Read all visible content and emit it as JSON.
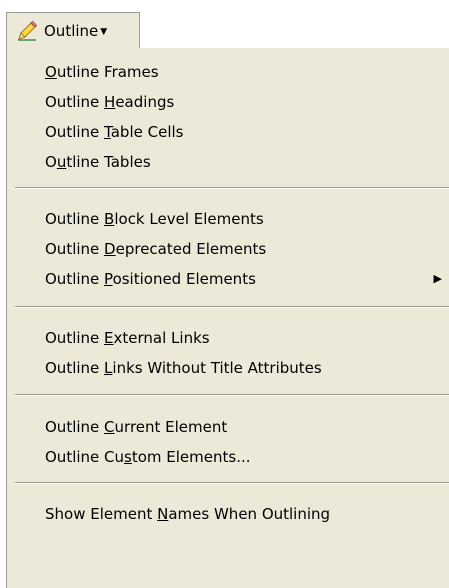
{
  "toolbar": {
    "button_label": "Outline",
    "button_icon": "pencil-icon",
    "dropdown_icon": "caret-down-icon"
  },
  "menu": {
    "groups": [
      {
        "items": [
          {
            "label": "Outline Frames",
            "mnemonic": "O"
          },
          {
            "label": "Outline Headings",
            "mnemonic": "H"
          },
          {
            "label": "Outline Table Cells",
            "mnemonic": "T"
          },
          {
            "label": "Outline Tables",
            "mnemonic": "u"
          }
        ]
      },
      {
        "items": [
          {
            "label": "Outline Block Level Elements",
            "mnemonic": "B"
          },
          {
            "label": "Outline Deprecated Elements",
            "mnemonic": "D"
          },
          {
            "label": "Outline Positioned Elements",
            "mnemonic": "P",
            "has_submenu": true,
            "submenu_icon": "submenu-arrow-icon"
          }
        ]
      },
      {
        "items": [
          {
            "label": "Outline External Links",
            "mnemonic": "E"
          },
          {
            "label": "Outline Links Without Title Attributes",
            "mnemonic": "L"
          }
        ]
      },
      {
        "items": [
          {
            "label": "Outline Current Element",
            "mnemonic": "C"
          },
          {
            "label": "Outline Custom Elements...",
            "mnemonic": "s"
          }
        ]
      },
      {
        "items": [
          {
            "label": "Show Element Names When Outlining",
            "mnemonic": "N"
          }
        ]
      }
    ]
  }
}
